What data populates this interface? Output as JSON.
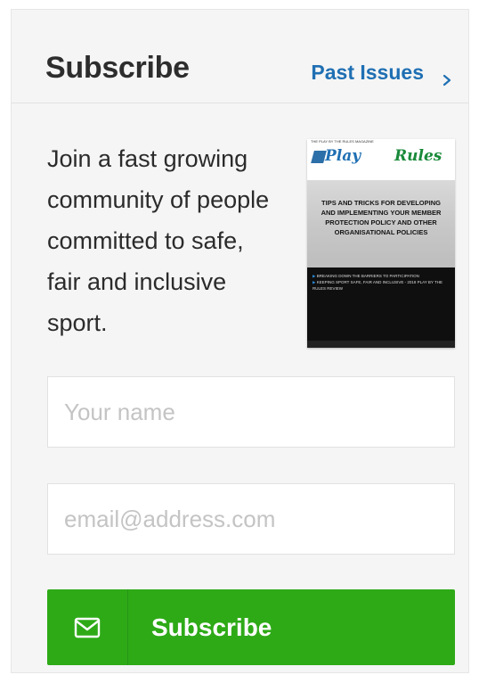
{
  "header": {
    "title": "Subscribe",
    "past_issues_label": "Past Issues",
    "past_issues_icon": "chevron-right-icon"
  },
  "intro": {
    "text": "Join a fast growing community of people committed to safe, fair and inclusive sport."
  },
  "cover": {
    "top_strip": "THE PLAY BY THE RULES MAGAZINE",
    "logo_play": "Play",
    "logo_rules": "Rules",
    "headline": "Tips and tricks for developing and implementing your member protection policy and other organisational policies",
    "bullets": [
      "BREAKING DOWN THE BARRIERS TO PARTICIPATION",
      "KEEPING SPORT SAFE, FAIR AND INCLUSIVE - 2018 PLAY BY THE RULES REVIEW"
    ]
  },
  "form": {
    "name_placeholder": "Your name",
    "name_value": "",
    "email_placeholder": "email@address.com",
    "email_value": ""
  },
  "button": {
    "label": "Subscribe",
    "icon": "envelope-icon"
  },
  "colors": {
    "accent_link": "#1f6fb3",
    "button_green": "#2eaa17",
    "panel_bg": "#f5f5f5",
    "title_text": "#2d2d2d"
  }
}
